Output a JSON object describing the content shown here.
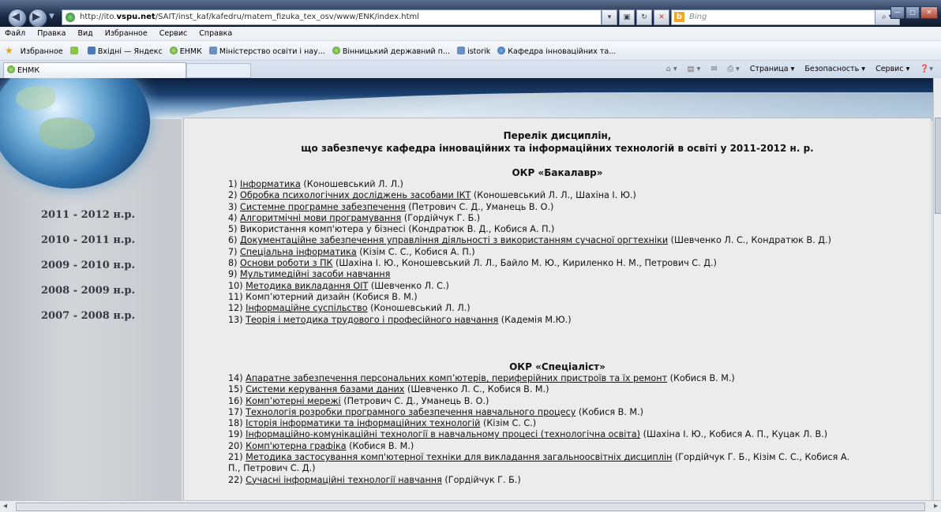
{
  "browser": {
    "url_prefix": "http://ito.",
    "url_domain": "vspu.net",
    "url_path": "/SAIT/inst_kaf/kafedru/matem_fizuka_tex_osv/www/ENK/index.html",
    "search_placeholder": "Bing",
    "menu": [
      "Файл",
      "Правка",
      "Вид",
      "Избранное",
      "Сервис",
      "Справка"
    ],
    "favorites_label": "Избранное",
    "favorites": [
      {
        "label": "Вхідні — Яндекс",
        "icon": "mail-icon"
      },
      {
        "label": "ЕНМК",
        "icon": "globe-icon"
      },
      {
        "label": "Міністерство освіти і нау...",
        "icon": "ie-page-icon"
      },
      {
        "label": "Вінницький державний п...",
        "icon": "globe-icon"
      },
      {
        "label": "istorik",
        "icon": "ie-page-icon"
      },
      {
        "label": "Кафедра інноваційних та...",
        "icon": "globe-blue-icon"
      }
    ],
    "tab_title": "ЕНМК",
    "commands": [
      "Страница ▾",
      "Безопасность ▾",
      "Сервис ▾"
    ]
  },
  "sidebar": {
    "years": [
      "2011 - 2012 н.р.",
      "2010 - 2011 н.р.",
      "2009 - 2010 н.р.",
      "2008 - 2009 н.р.",
      "2007 - 2008 н.р."
    ]
  },
  "main": {
    "heading_line1": "Перелік  дисциплін,",
    "heading_line2": "що забезпечує кафедра інноваційних та інформаційних технологій в освіті у 2011-2012 н. р.",
    "bachelor_title": "ОКР «Бакалавр»",
    "bachelor": [
      {
        "n": "1) ",
        "link": "Інформатика",
        "rest": " (Коношевський Л. Л.)"
      },
      {
        "n": "2) ",
        "link": "Обробка психологічних досліджень засобами ІКТ",
        "rest": " (Коношевський Л. Л., Шахіна І. Ю.)"
      },
      {
        "n": "3) ",
        "link": "Системне програмне забезпечення",
        "rest": " (Петрович С. Д., Уманець В. О.)"
      },
      {
        "n": "4) ",
        "link": "Алгоритмічні мови програмування",
        "rest": " (Гордійчук Г. Б.)"
      },
      {
        "n": "5) ",
        "link": "",
        "rest": "Використання комп'ютера у бізнесі (Кондратюк В. Д., Кобися А. П.)"
      },
      {
        "n": "6) ",
        "link": "Документаційне забезпечення управління діяльності з використанням сучасної оргтехніки",
        "rest": " (Шевченко Л. С., Кондратюк В. Д.)"
      },
      {
        "n": "7) ",
        "link": "Спеціальна інформатика",
        "rest": " (Кізім С. С., Кобися А. П.)"
      },
      {
        "n": "8) ",
        "link": "Основи роботи з ПК",
        "rest": " (Шахіна І. Ю., Коношевський Л. Л., Байло М. Ю., Кириленко Н. М., Петрович С. Д.)"
      },
      {
        "n": "9) ",
        "link": "Мультимедійні засоби навчання",
        "rest": ""
      },
      {
        "n": "10) ",
        "link": "Методика викладання  ОІТ",
        "rest": " (Шевченко Л. С.)"
      },
      {
        "n": "11) ",
        "link": "",
        "rest": "Комп’ютерний дизайн (Кобися В. М.)"
      },
      {
        "n": "12) ",
        "link": "Інформаційне суспільство",
        "rest": " (Коношевський Л. Л.)"
      },
      {
        "n": "13) ",
        "link": "Теорія і методика трудового і професійного навчання",
        "rest": " (Кадемія М.Ю.)"
      }
    ],
    "specialist_title": "ОКР «Спеціаліст»",
    "specialist": [
      {
        "n": "14) ",
        "link": "Апаратне забезпечення персональних комп’ютерів, периферійних пристроїв та їх ремонт",
        "rest": " (Кобися В. М.)"
      },
      {
        "n": "15) ",
        "link": "Системи керування базами даних",
        "rest": " (Шевченко Л. С.,  Кобися В. М.)"
      },
      {
        "n": "16) ",
        "link": "Комп’ютерні мережі",
        "rest": " (Петрович С. Д., Уманець В. О.)"
      },
      {
        "n": "17) ",
        "link": "Технологія розробки програмного забезпечення навчального процесу",
        "rest": " (Кобися В. М.)"
      },
      {
        "n": "18) ",
        "link": "Історія інформатики та інформаційних технологій",
        "rest": " (Кізім С. С.)"
      },
      {
        "n": "19) ",
        "link": "Інформаційно-комунікаційні технології в навчальному процесі (технологічна освіта)",
        "rest": " (Шахіна І. Ю., Кобися А. П., Куцак Л. В.)"
      },
      {
        "n": "20) ",
        "link": "Комп'ютерна графіка",
        "rest": " (Кобися В. М.)"
      },
      {
        "n": "21) ",
        "link": "Методика застосування комп'ютерної техніки для викладання загальноосвітніх дисциплін",
        "rest": " (Гордійчук Г. Б., Кізім С. С., Кобися А. П., Петрович С. Д.)"
      },
      {
        "n": "22) ",
        "link": "Сучасні інформаційні технології навчання",
        "rest": " (Гордійчук Г. Б.)"
      }
    ]
  }
}
